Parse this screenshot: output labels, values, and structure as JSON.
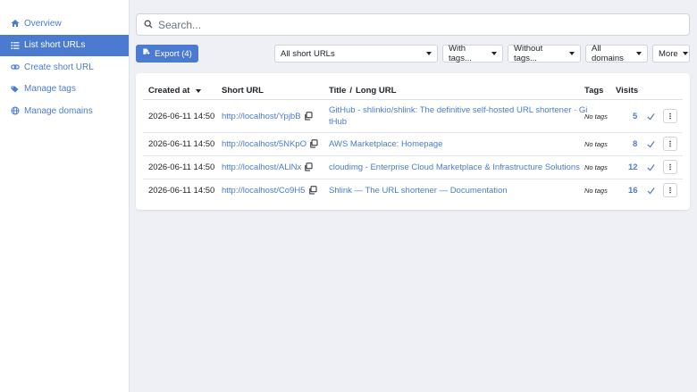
{
  "sidebar": {
    "items": [
      {
        "label": "Overview",
        "icon": "home-icon",
        "active": false
      },
      {
        "label": "List short URLs",
        "icon": "list-icon",
        "active": true
      },
      {
        "label": "Create short URL",
        "icon": "link-icon",
        "active": false
      },
      {
        "label": "Manage tags",
        "icon": "tags-icon",
        "active": false
      },
      {
        "label": "Manage domains",
        "icon": "globe-icon",
        "active": false
      }
    ]
  },
  "search": {
    "placeholder": "Search..."
  },
  "toolbar": {
    "export_label": "Export (4)",
    "filter_all": "All short URLs",
    "with_tags": "With tags...",
    "without_tags": "Without tags...",
    "all_domains": "All domains",
    "more": "More"
  },
  "table": {
    "headers": {
      "created": "Created at",
      "short_url": "Short URL",
      "title": "Title",
      "title_sep": "/",
      "long_url": "Long URL",
      "tags": "Tags",
      "visits": "Visits"
    },
    "rows": [
      {
        "created": "2026-06-11 14:50",
        "short_url": "http://localhost/YpjbB",
        "title_line1": "GitHub - shlinkio/shlink: The definitive self-hosted URL shortener · Gi",
        "title_line2": "tHub",
        "tags": "No tags",
        "visits": "5"
      },
      {
        "created": "2026-06-11 14:50",
        "short_url": "http://localhost/5NKpO",
        "title_line1": "AWS Marketplace: Homepage",
        "title_line2": "",
        "tags": "No tags",
        "visits": "8"
      },
      {
        "created": "2026-06-11 14:50",
        "short_url": "http://localhost/ALlNx",
        "title_line1": "cloudimg - Enterprise Cloud Marketplace & Infrastructure Solutions",
        "title_line2": "",
        "tags": "No tags",
        "visits": "12"
      },
      {
        "created": "2026-06-11 14:50",
        "short_url": "http://localhost/Co9H5",
        "title_line1": "Shlink — The URL shortener — Documentation",
        "title_line2": "",
        "tags": "No tags",
        "visits": "16"
      }
    ]
  },
  "colors": {
    "accent": "#4a7bd0",
    "background": "#eef0f5"
  }
}
